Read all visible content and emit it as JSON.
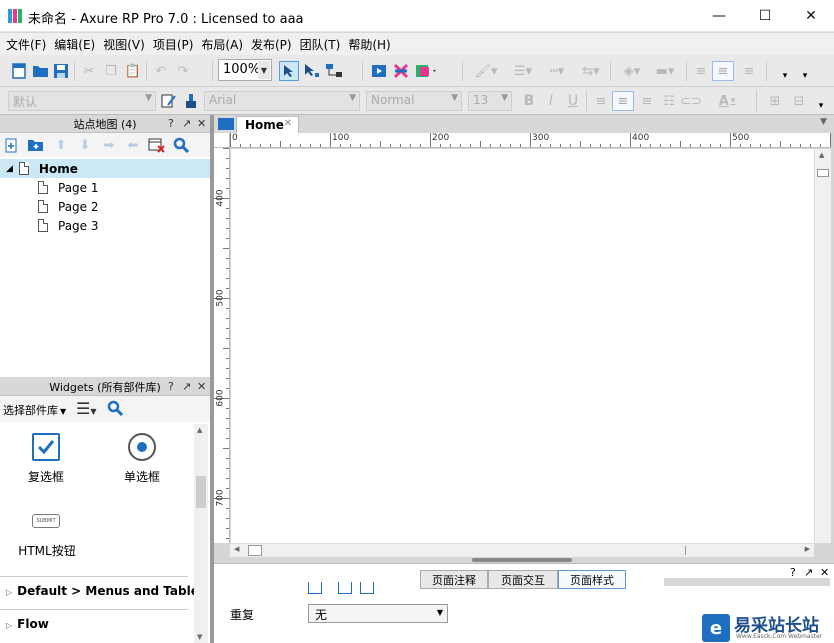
{
  "window": {
    "title": "未命名 - Axure RP Pro 7.0 : Licensed to aaa",
    "minimize": "—",
    "maximize": "☐",
    "close": "✕"
  },
  "menubar": {
    "items": [
      {
        "label": "文件(F)"
      },
      {
        "label": "编辑(E)"
      },
      {
        "label": "视图(V)"
      },
      {
        "label": "项目(P)"
      },
      {
        "label": "布局(A)"
      },
      {
        "label": "发布(P)"
      },
      {
        "label": "团队(T)"
      },
      {
        "label": "帮助(H)"
      }
    ]
  },
  "toolbar": {
    "zoom": "100%",
    "style_combo": "默认",
    "font_combo": "Arial",
    "weight_combo": "Normal",
    "size_combo": "13",
    "bold": "B",
    "italic": "I",
    "underline": "U",
    "text_color_glyph": "A"
  },
  "sitemap": {
    "title": "站点地图 (4)",
    "help": "?",
    "pin": "↗",
    "close": "✕",
    "home": "Home",
    "pages": [
      "Page 1",
      "Page 2",
      "Page 3"
    ]
  },
  "widgets": {
    "title": "Widgets (所有部件库)",
    "help": "?",
    "pin": "↗",
    "close": "✕",
    "library_select": "选择部件库",
    "checkbox_label": "复选框",
    "radio_label": "单选框",
    "submit_icon_text": "SUBMIT",
    "html_button_label": "HTML按钮",
    "sections": [
      "Default > Menus and Table",
      "Flow"
    ]
  },
  "canvas": {
    "tab": "Home",
    "tab_close": "✕",
    "ruler_x": [
      "0",
      "100",
      "200",
      "300",
      "400",
      "500"
    ],
    "ruler_y": [
      "400",
      "500",
      "600",
      "700"
    ]
  },
  "bottom_pane": {
    "tabs": [
      "页面注释",
      "页面交互",
      "页面样式"
    ],
    "active_tab": "页面样式",
    "repeat_label": "重复",
    "repeat_value": "无",
    "help": "?",
    "pin": "↗",
    "close": "✕"
  },
  "watermark": {
    "name": "易采站长站",
    "url": "Www.Easck.Com Webmaster"
  },
  "colors": {
    "accent": "#1e6fc0",
    "selection": "#cce8f6",
    "active_tab_border": "#5b9bd5"
  }
}
